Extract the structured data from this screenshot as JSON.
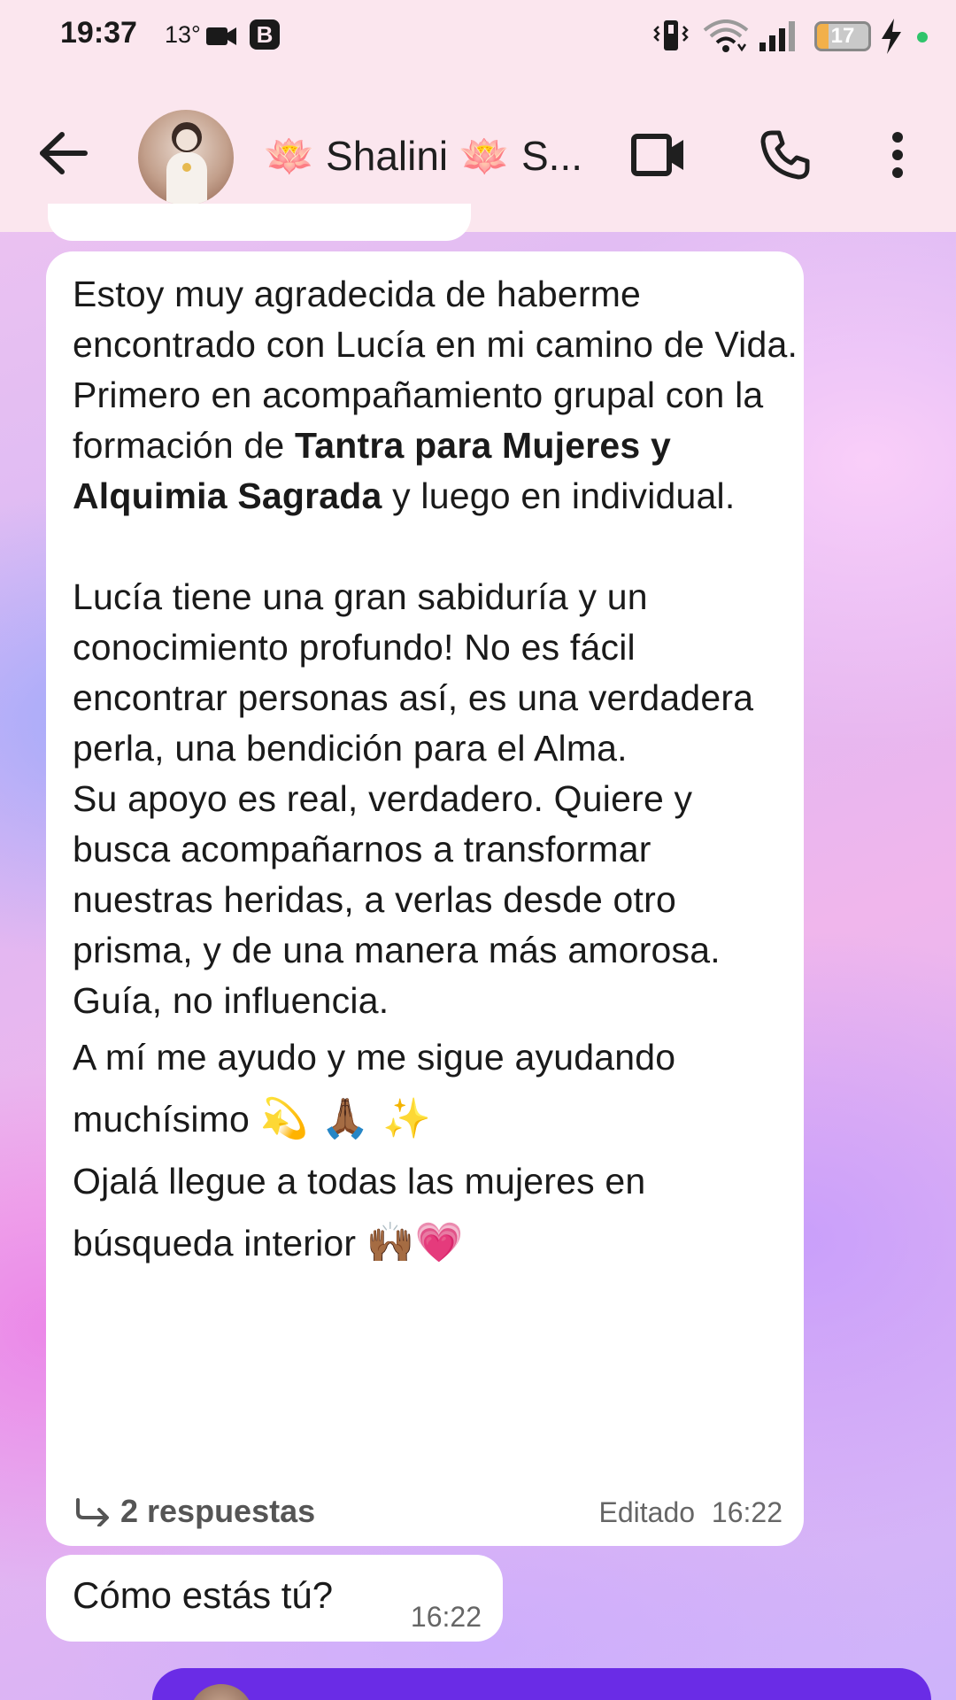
{
  "status_bar": {
    "time": "19:37",
    "temperature": "13°",
    "b_badge": "B",
    "battery": "17",
    "icons": [
      "video-camera-icon",
      "vibrate-icon",
      "wifi-icon",
      "signal-icon",
      "battery-icon",
      "charging-bolt-icon"
    ]
  },
  "header": {
    "contact_name": "🪷 Shalini 🪷 S...",
    "icons": [
      "back-arrow-icon",
      "video-call-icon",
      "phone-call-icon",
      "more-options-icon"
    ]
  },
  "messages": [
    {
      "type": "incoming",
      "paragraphs": {
        "p1": "Estoy muy agradecida de haberme encontrado con Lucía en mi camino de Vida.",
        "p2_start": "Primero en  acompañamiento grupal con la formación de ",
        "p2_bold": "Tantra para Mujeres y Alquimia Sagrada",
        "p2_end": " y luego en individual.",
        "p3": "Lucía tiene una gran sabiduría y un conocimiento profundo! No es fácil encontrar personas así, es una verdadera perla, una bendición para el Alma.",
        "p4": "Su apoyo es real, verdadero. Quiere y busca acompañarnos a transformar nuestras heridas, a verlas desde otro prisma, y de una manera más amorosa.",
        "p5": "Guía, no influencia.",
        "p6_start": "A mí me ayudo y me sigue ayudando muchísimo ",
        "p6_emoji": "💫 🙏🏾 ✨",
        "p7_start": "Ojalá llegue a todas las mujeres en búsqueda interior ",
        "p7_emoji": "🙌🏾💗"
      },
      "replies": "2 respuestas",
      "edited": "Editado",
      "time": "16:22"
    },
    {
      "type": "incoming",
      "text": "Cómo estás tú?",
      "time": "16:22"
    }
  ],
  "colors": {
    "header_bg": "#fbe6ee",
    "bubble_bg": "#ffffff",
    "outgoing_bubble": "#6a2ce6",
    "online_dot": "#2fc46b"
  }
}
